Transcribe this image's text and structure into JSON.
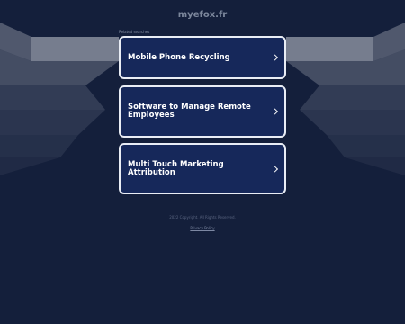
{
  "site": {
    "domain": "myefox.fr"
  },
  "related": {
    "label": "Related searches",
    "links": [
      {
        "label": "Mobile Phone Recycling"
      },
      {
        "label": "Software to Manage Remote Employees"
      },
      {
        "label": "Multi Touch Marketing Attribution"
      }
    ]
  },
  "footer": {
    "copyright": "2022 Copyright. All Rights Reserved.",
    "privacy": "Privacy Policy"
  },
  "colors": {
    "background": "#141f3b",
    "card_fill": "#16285a",
    "card_border": "#e9edf5",
    "text": "#ffffff"
  },
  "icons": {
    "link_arrow": "chevron-right-icon"
  }
}
